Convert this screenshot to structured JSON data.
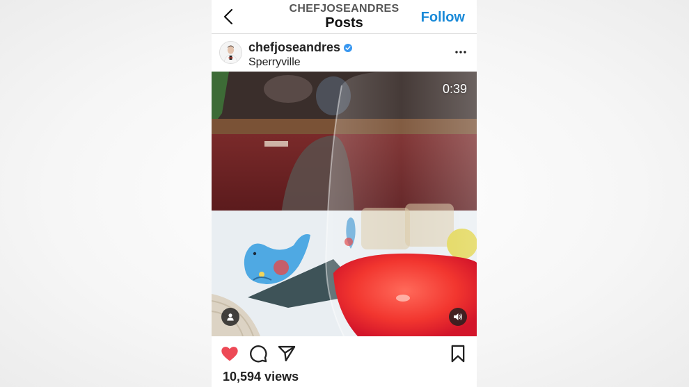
{
  "header": {
    "account_name": "CHEFJOSEANDRES",
    "title": "Posts",
    "follow_label": "Follow"
  },
  "post": {
    "username": "chefjoseandres",
    "verified": true,
    "location": "Sperryville",
    "video_time": "0:39",
    "liked": true,
    "views": "10,594 views"
  },
  "icons": {
    "back": "chevron-left-icon",
    "more": "more-horizontal-icon",
    "tag": "person-tag-icon",
    "sound": "speaker-icon",
    "like": "heart-icon",
    "comment": "comment-icon",
    "share": "paper-plane-icon",
    "save": "bookmark-icon"
  },
  "colors": {
    "accent": "#1a8ad8",
    "like": "#ed4956",
    "verified": "#3897f0"
  }
}
